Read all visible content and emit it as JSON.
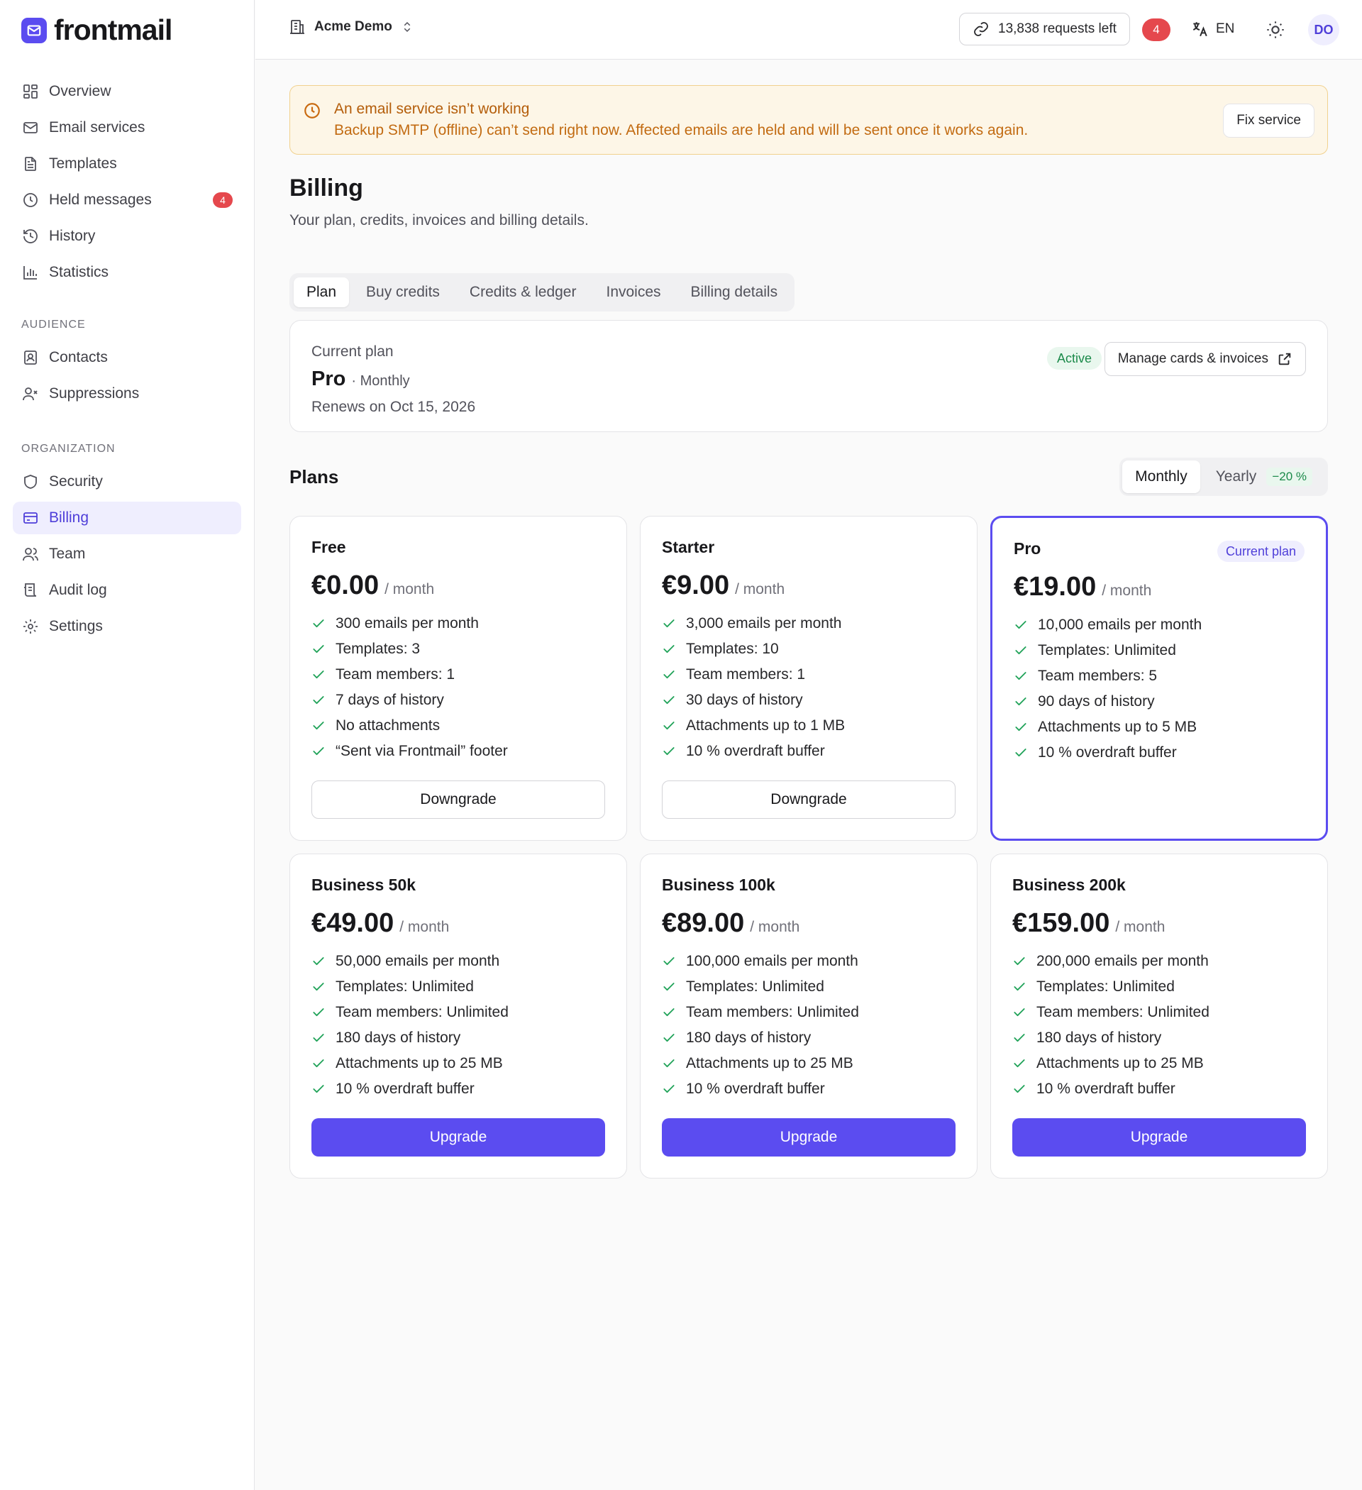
{
  "brand": {
    "name": "frontmail",
    "accent": "#5b4cf0"
  },
  "sidebar": {
    "items": [
      {
        "label": "Overview",
        "icon": "grid-icon"
      },
      {
        "label": "Email services",
        "icon": "mail-icon"
      },
      {
        "label": "Templates",
        "icon": "file-icon"
      },
      {
        "label": "Held messages",
        "icon": "clock-icon",
        "badge": "4"
      },
      {
        "label": "History",
        "icon": "history-icon"
      },
      {
        "label": "Statistics",
        "icon": "bar-chart-icon"
      }
    ],
    "audience_heading": "AUDIENCE",
    "audience": [
      {
        "label": "Contacts",
        "icon": "contact-icon"
      },
      {
        "label": "Suppressions",
        "icon": "user-x-icon"
      }
    ],
    "organization_heading": "ORGANIZATION",
    "organization": [
      {
        "label": "Security",
        "icon": "shield-icon"
      },
      {
        "label": "Billing",
        "icon": "credit-card-icon",
        "active": true
      },
      {
        "label": "Team",
        "icon": "users-icon"
      },
      {
        "label": "Audit log",
        "icon": "list-icon"
      },
      {
        "label": "Settings",
        "icon": "gear-icon"
      }
    ]
  },
  "header": {
    "org_name": "Acme Demo",
    "requests_left": "13,838 requests left",
    "notification_count": "4",
    "language": "EN",
    "avatar_initials": "DO"
  },
  "alert": {
    "title": "An email service isn’t working",
    "message": "Backup SMTP (offline) can’t send right now. Affected emails are held and will be sent once it works again.",
    "action": "Fix service"
  },
  "page": {
    "title": "Billing",
    "subtitle": "Your plan, credits, invoices and billing details."
  },
  "tabs": [
    "Plan",
    "Buy credits",
    "Credits & ledger",
    "Invoices",
    "Billing details"
  ],
  "current_plan": {
    "label": "Current plan",
    "name": "Pro",
    "period": "· Monthly",
    "renews": "Renews on Oct 15, 2026",
    "status": "Active",
    "manage_label": "Manage cards & invoices"
  },
  "plans_section": {
    "title": "Plans",
    "period_monthly": "Monthly",
    "period_yearly": "Yearly",
    "yearly_discount": "−20 %",
    "selected_period": "Monthly"
  },
  "plans": [
    {
      "name": "Free",
      "price": "€0.00",
      "unit": "/ month",
      "features": [
        "300 emails per month",
        "Templates: 3",
        "Team members: 1",
        "7 days of history",
        "No attachments",
        "“Sent via Frontmail” footer"
      ],
      "action": "Downgrade",
      "style": "outline"
    },
    {
      "name": "Starter",
      "price": "€9.00",
      "unit": "/ month",
      "features": [
        "3,000 emails per month",
        "Templates: 10",
        "Team members: 1",
        "30 days of history",
        "Attachments up to 1 MB",
        "10 % overdraft buffer"
      ],
      "action": "Downgrade",
      "style": "outline"
    },
    {
      "name": "Pro",
      "price": "€19.00",
      "unit": "/ month",
      "badge": "Current plan",
      "features": [
        "10,000 emails per month",
        "Templates: Unlimited",
        "Team members: 5",
        "90 days of history",
        "Attachments up to 5 MB",
        "10 % overdraft buffer"
      ],
      "action": "",
      "style": "current"
    },
    {
      "name": "Business 50k",
      "price": "€49.00",
      "unit": "/ month",
      "features": [
        "50,000 emails per month",
        "Templates: Unlimited",
        "Team members: Unlimited",
        "180 days of history",
        "Attachments up to 25 MB",
        "10 % overdraft buffer"
      ],
      "action": "Upgrade",
      "style": "primary"
    },
    {
      "name": "Business 100k",
      "price": "€89.00",
      "unit": "/ month",
      "features": [
        "100,000 emails per month",
        "Templates: Unlimited",
        "Team members: Unlimited",
        "180 days of history",
        "Attachments up to 25 MB",
        "10 % overdraft buffer"
      ],
      "action": "Upgrade",
      "style": "primary"
    },
    {
      "name": "Business 200k",
      "price": "€159.00",
      "unit": "/ month",
      "features": [
        "200,000 emails per month",
        "Templates: Unlimited",
        "Team members: Unlimited",
        "180 days of history",
        "Attachments up to 25 MB",
        "10 % overdraft buffer"
      ],
      "action": "Upgrade",
      "style": "primary"
    }
  ]
}
